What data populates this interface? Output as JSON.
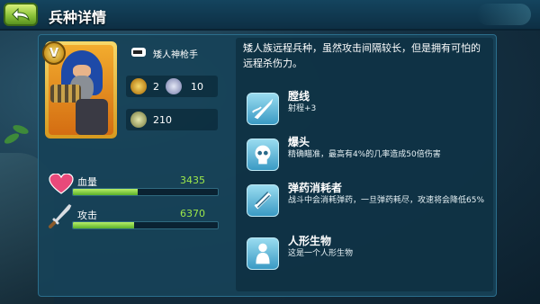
{
  "header": {
    "title": "兵种详情"
  },
  "unit": {
    "name": "矮人神枪手",
    "rank_badge": "V",
    "level": "2",
    "population": "10",
    "cost": "210"
  },
  "stats": {
    "hp": {
      "label": "血量",
      "value": "3435",
      "fill_fraction": 0.45
    },
    "attack": {
      "label": "攻击",
      "value": "6370",
      "fill_fraction": 0.42
    }
  },
  "description": "矮人族远程兵种，虽然攻击间隔较长，但是拥有可怕的远程杀伤力。",
  "skills": [
    {
      "name": "膛线",
      "desc": "射程+3",
      "icon": "bullet-icon"
    },
    {
      "name": "爆头",
      "desc": "精确瞄准，最高有4%的几率造成50倍伤害",
      "icon": "skull-icon"
    },
    {
      "name": "弹药消耗者",
      "desc": "战斗中会消耗弹药，一旦弹药耗尽，攻速将会降低65%",
      "icon": "ammo-icon"
    },
    {
      "name": "人形生物",
      "desc": "这是一个人形生物",
      "icon": "humanoid-icon"
    }
  ],
  "colors": {
    "bar_green": "#5ab02a",
    "value_green": "#9de84a",
    "panel": "#174258",
    "back_button": "#8cc33a"
  }
}
